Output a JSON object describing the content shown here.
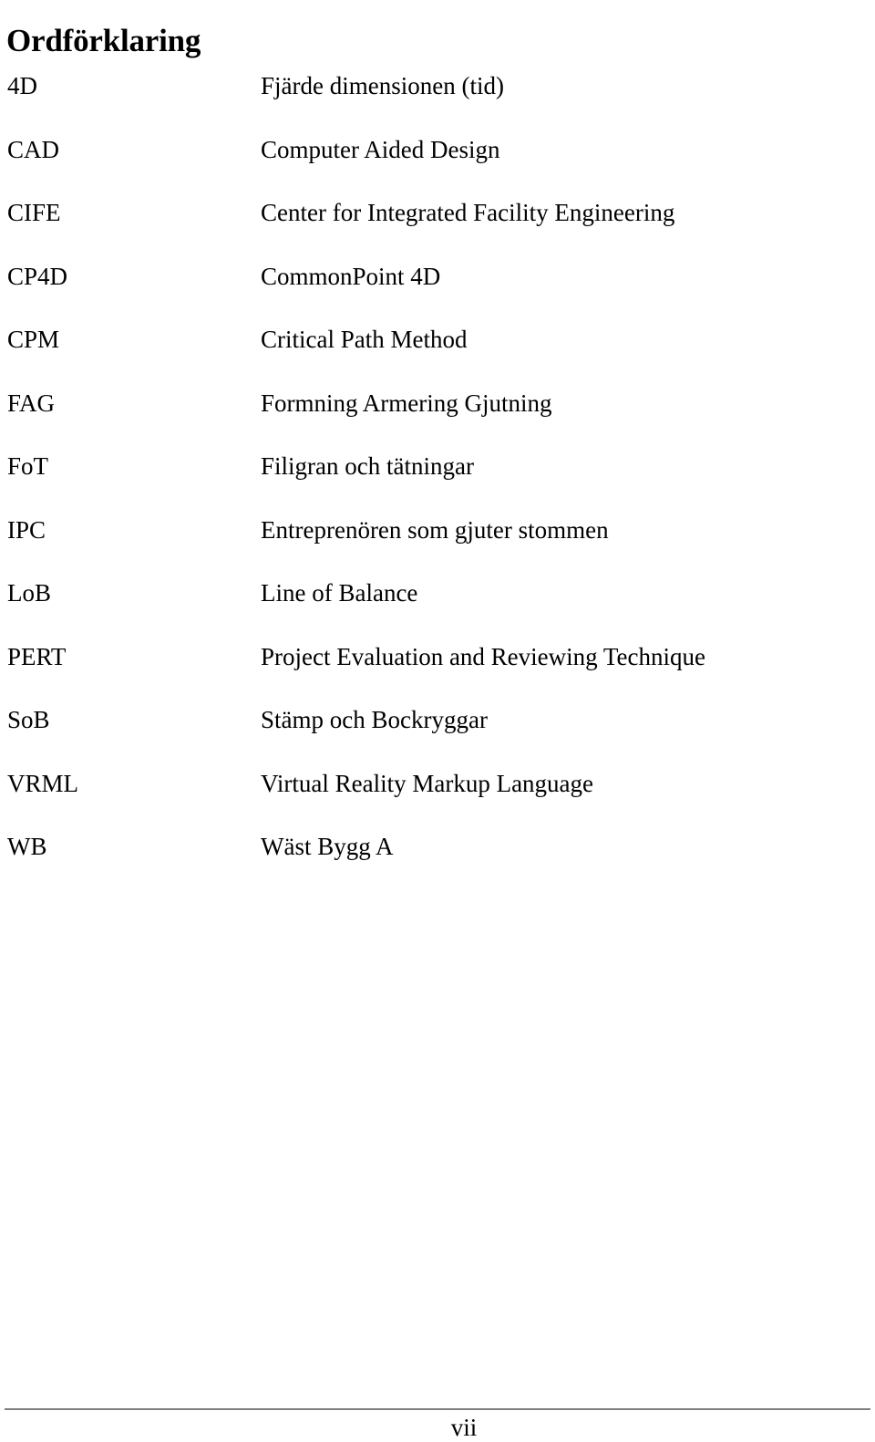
{
  "document": {
    "title": "Ordförklaring",
    "glossary": [
      {
        "term": "4D",
        "definition": "Fjärde dimensionen (tid)"
      },
      {
        "term": "CAD",
        "definition": "Computer Aided Design"
      },
      {
        "term": "CIFE",
        "definition": "Center for Integrated Facility Engineering"
      },
      {
        "term": "CP4D",
        "definition": "CommonPoint 4D"
      },
      {
        "term": "CPM",
        "definition": "Critical Path Method"
      },
      {
        "term": "FAG",
        "definition": "Formning Armering Gjutning"
      },
      {
        "term": "FoT",
        "definition": "Filigran och tätningar"
      },
      {
        "term": "IPC",
        "definition": "Entreprenören som gjuter stommen"
      },
      {
        "term": "LoB",
        "definition": "Line of Balance"
      },
      {
        "term": "PERT",
        "definition": "Project Evaluation and Reviewing Technique"
      },
      {
        "term": "SoB",
        "definition": "Stämp och Bockryggar"
      },
      {
        "term": "VRML",
        "definition": "Virtual Reality Markup Language"
      },
      {
        "term": "WB",
        "definition": "Wäst Bygg A"
      }
    ],
    "footer": {
      "page_number": "vii",
      "rule_color": "#808080"
    }
  }
}
